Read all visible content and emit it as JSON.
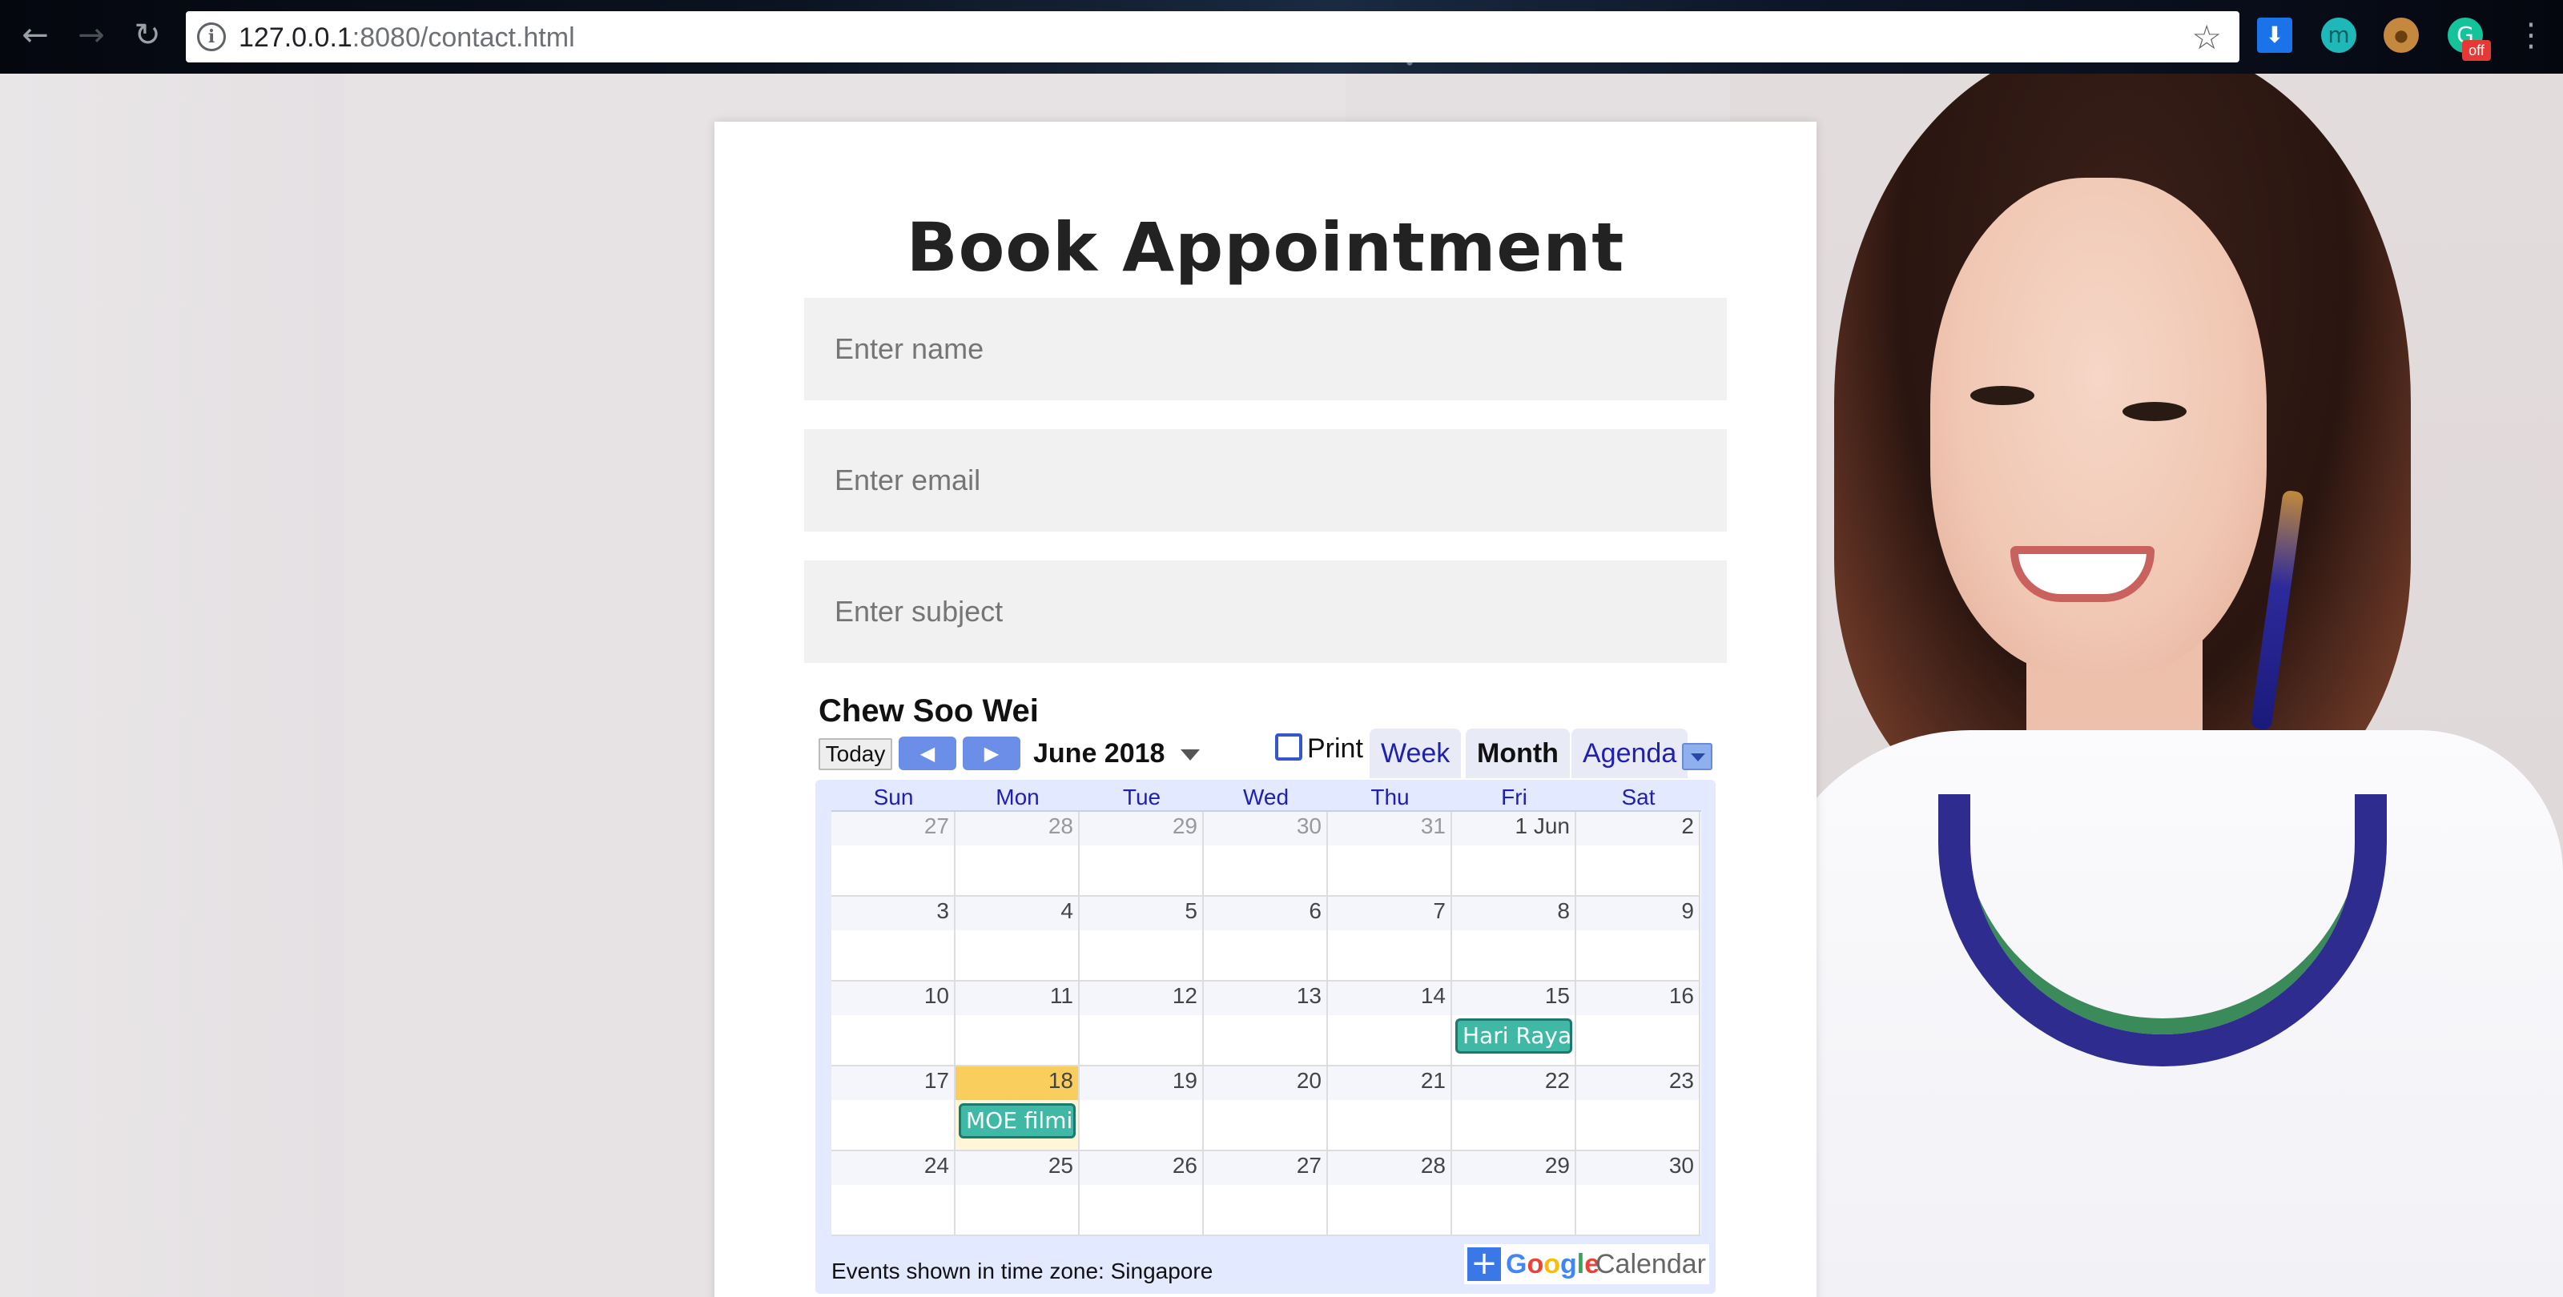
{
  "browser": {
    "url_host": "127.0.0.1",
    "url_rest": ":8080/contact.html",
    "icons": [
      "back-icon",
      "forward-icon",
      "reload-icon",
      "info-icon",
      "bookmark-star-icon",
      "download-extension-icon",
      "m-extension-icon",
      "cookie-extension-icon",
      "grammarly-extension-icon",
      "menu-icon"
    ],
    "ext_badge": "off"
  },
  "page": {
    "title": "Book Appointment",
    "fields": [
      {
        "placeholder": "Enter name"
      },
      {
        "placeholder": "Enter email"
      },
      {
        "placeholder": "Enter subject"
      }
    ]
  },
  "calendar": {
    "owner": "Chew Soo Wei",
    "today_label": "Today",
    "month_label": "June 2018",
    "print_label": "Print",
    "tabs": [
      "Week",
      "Month",
      "Agenda"
    ],
    "active_tab": "Month",
    "weekdays": [
      "Sun",
      "Mon",
      "Tue",
      "Wed",
      "Thu",
      "Fri",
      "Sat"
    ],
    "weeks": [
      [
        "27",
        "28",
        "29",
        "30",
        "31",
        "1 Jun",
        "2"
      ],
      [
        "3",
        "4",
        "5",
        "6",
        "7",
        "8",
        "9"
      ],
      [
        "10",
        "11",
        "12",
        "13",
        "14",
        "15",
        "16"
      ],
      [
        "17",
        "18",
        "19",
        "20",
        "21",
        "22",
        "23"
      ],
      [
        "24",
        "25",
        "26",
        "27",
        "28",
        "29",
        "30"
      ]
    ],
    "other_month_days": 5,
    "today_cell": "18",
    "events": [
      {
        "day": "15",
        "title": "Hari Raya"
      },
      {
        "day": "18",
        "title": "MOE filmi"
      }
    ],
    "timezone_text": "Events shown in time zone: Singapore",
    "brand_google": "Google",
    "brand_calendar": "Calendar",
    "colors": {
      "event": "#3fb8a6",
      "today": "#f9ce5c",
      "nav": "#6b8ee8",
      "link": "#2020b0"
    }
  }
}
